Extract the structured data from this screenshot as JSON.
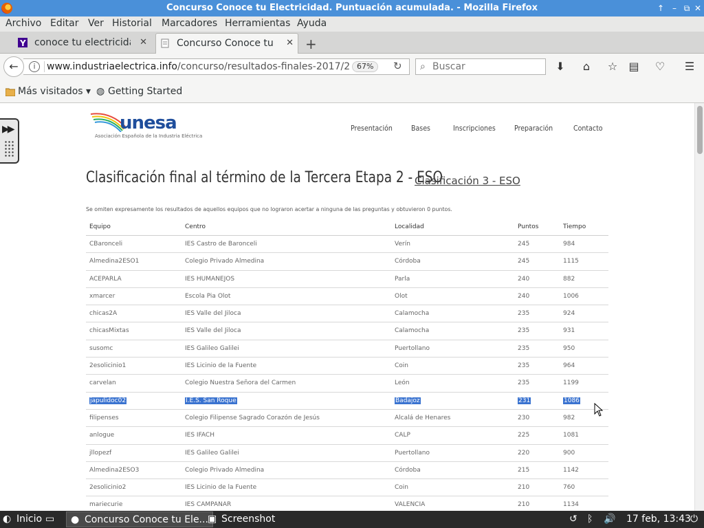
{
  "window": {
    "title": "Concurso Conoce tu Electricidad. Puntuación acumulada. - Mozilla Firefox"
  },
  "menu": [
    "Archivo",
    "Editar",
    "Ver",
    "Historial",
    "Marcadores",
    "Herramientas",
    "Ayuda"
  ],
  "tabs": [
    {
      "label": "conoce tu electricida...",
      "active": false
    },
    {
      "label": "Concurso Conoce tu ...",
      "active": true
    }
  ],
  "nav": {
    "url_domain": "www.industriaelectrica.info",
    "url_path": "/concurso/resultados-finales-2017/2",
    "zoom": "67%",
    "search_placeholder": "Buscar"
  },
  "bookmarks": {
    "most_visited": "Más visitados",
    "getting_started": "Getting Started"
  },
  "site": {
    "logo_text": "unesa",
    "logo_subtitle": "Asociación Española de la Industria Eléctrica",
    "nav": [
      "Presentación",
      "Bases",
      "Inscripciones",
      "Preparación",
      "Contacto"
    ],
    "heading": "Clasificación final al término de la Tercera Etapa 2 - ESO",
    "heading_link": "Clasificación 3 - ESO",
    "note": "Se omiten expresamente los resultados de aquellos equipos que no lograron acertar a ninguna de las preguntas y obtuvieron 0 puntos."
  },
  "table": {
    "headers": [
      "Equipo",
      "Centro",
      "Localidad",
      "Puntos",
      "Tiempo"
    ],
    "rows": [
      [
        "CBaronceli",
        "IES Castro de Baronceli",
        "Verín",
        "245",
        "984"
      ],
      [
        "Almedina2ESO1",
        "Colegio Privado Almedina",
        "Córdoba",
        "245",
        "1115"
      ],
      [
        "ACEPARLA",
        "IES HUMANEJOS",
        "Parla",
        "240",
        "882"
      ],
      [
        "xmarcer",
        "Escola Pia Olot",
        "Olot",
        "240",
        "1006"
      ],
      [
        "chicas2A",
        "IES Valle del Jiloca",
        "Calamocha",
        "235",
        "924"
      ],
      [
        "chicasMixtas",
        "IES Valle del Jiloca",
        "Calamocha",
        "235",
        "931"
      ],
      [
        "susomc",
        "IES Galileo Galilei",
        "Puertollano",
        "235",
        "950"
      ],
      [
        "2esolicinio1",
        "IES Licinio de la Fuente",
        "Coin",
        "235",
        "964"
      ],
      [
        "carvelan",
        "Colegio Nuestra Señora del Carmen",
        "León",
        "235",
        "1199"
      ],
      [
        "japulidoc02",
        "I.E.S. San Roque",
        "Badajoz",
        "231",
        "1086"
      ],
      [
        "filipenses",
        "Colegio Filipense Sagrado Corazón de Jesús",
        "Alcalá de Henares",
        "230",
        "982"
      ],
      [
        "anlogue",
        "IES IFACH",
        "CALP",
        "225",
        "1081"
      ],
      [
        "jllopezf",
        "IES Galileo Galilei",
        "Puertollano",
        "220",
        "900"
      ],
      [
        "Almedina2ESO3",
        "Colegio Privado Almedina",
        "Córdoba",
        "215",
        "1142"
      ],
      [
        "2esolicinio2",
        "IES Licinio de la Fuente",
        "Coin",
        "210",
        "760"
      ],
      [
        "mariecurie",
        "IES CAMPANAR",
        "VALENCIA",
        "210",
        "1134"
      ]
    ],
    "selected_row": 9
  },
  "taskbar": {
    "start": "Inicio",
    "tasks": [
      {
        "label": "Concurso Conoce tu Ele...",
        "active": true
      },
      {
        "label": "Screenshot",
        "active": false
      }
    ],
    "clock": "17 feb, 13:43"
  },
  "colors": {
    "titlebar": "#4a90d9",
    "selection": "#3a73d0",
    "logo": "#1f4e9c"
  }
}
